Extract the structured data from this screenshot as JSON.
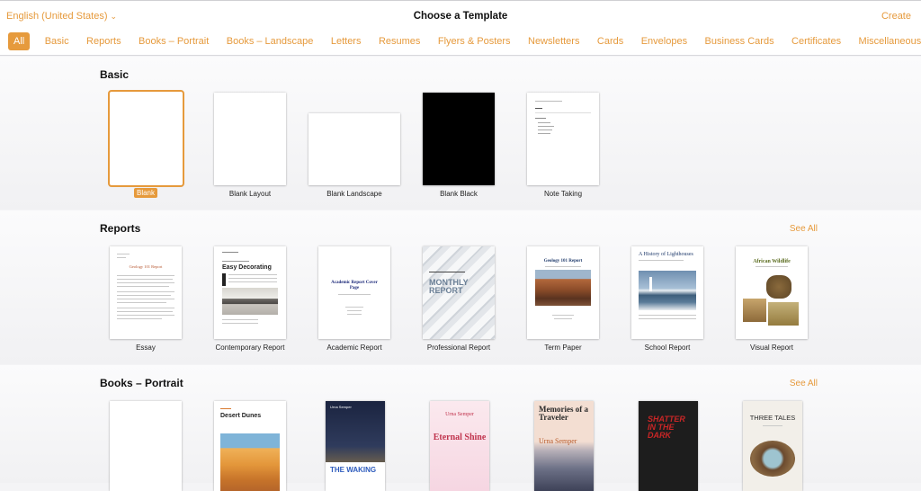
{
  "header": {
    "language": "English (United States)",
    "title": "Choose a Template",
    "create": "Create"
  },
  "tabs": [
    "All",
    "Basic",
    "Reports",
    "Books – Portrait",
    "Books – Landscape",
    "Letters",
    "Resumes",
    "Flyers & Posters",
    "Newsletters",
    "Cards",
    "Envelopes",
    "Business Cards",
    "Certificates",
    "Miscellaneous"
  ],
  "basic": {
    "title": "Basic",
    "items": [
      "Blank",
      "Blank Layout",
      "Blank Landscape",
      "Blank Black",
      "Note Taking"
    ]
  },
  "reports": {
    "title": "Reports",
    "see_all": "See All",
    "items": [
      "Essay",
      "Contemporary Report",
      "Academic Report",
      "Professional Report",
      "Term Paper",
      "School Report",
      "Visual Report"
    ],
    "covers": {
      "essay": "Geology 101 Report",
      "contemporary": "Easy Decorating",
      "academic": "Academic Report Cover Page",
      "professional": "MONTHLY REPORT",
      "term": "Geology 101 Report",
      "school": "A History of Lighthouses",
      "visual": "African Wildlife"
    }
  },
  "books": {
    "title": "Books – Portrait",
    "see_all": "See All",
    "covers": {
      "desert": "Desert Dunes",
      "waking_author": "Urna Semper",
      "waking": "THE WAKING",
      "eternal_author": "Urna Semper",
      "eternal": "Eternal Shine",
      "memories": "Memories of a Traveler",
      "memories_author": "Urna Semper",
      "shatter": "SHATTER IN THE DARK",
      "three": "THREE TALES"
    }
  }
}
